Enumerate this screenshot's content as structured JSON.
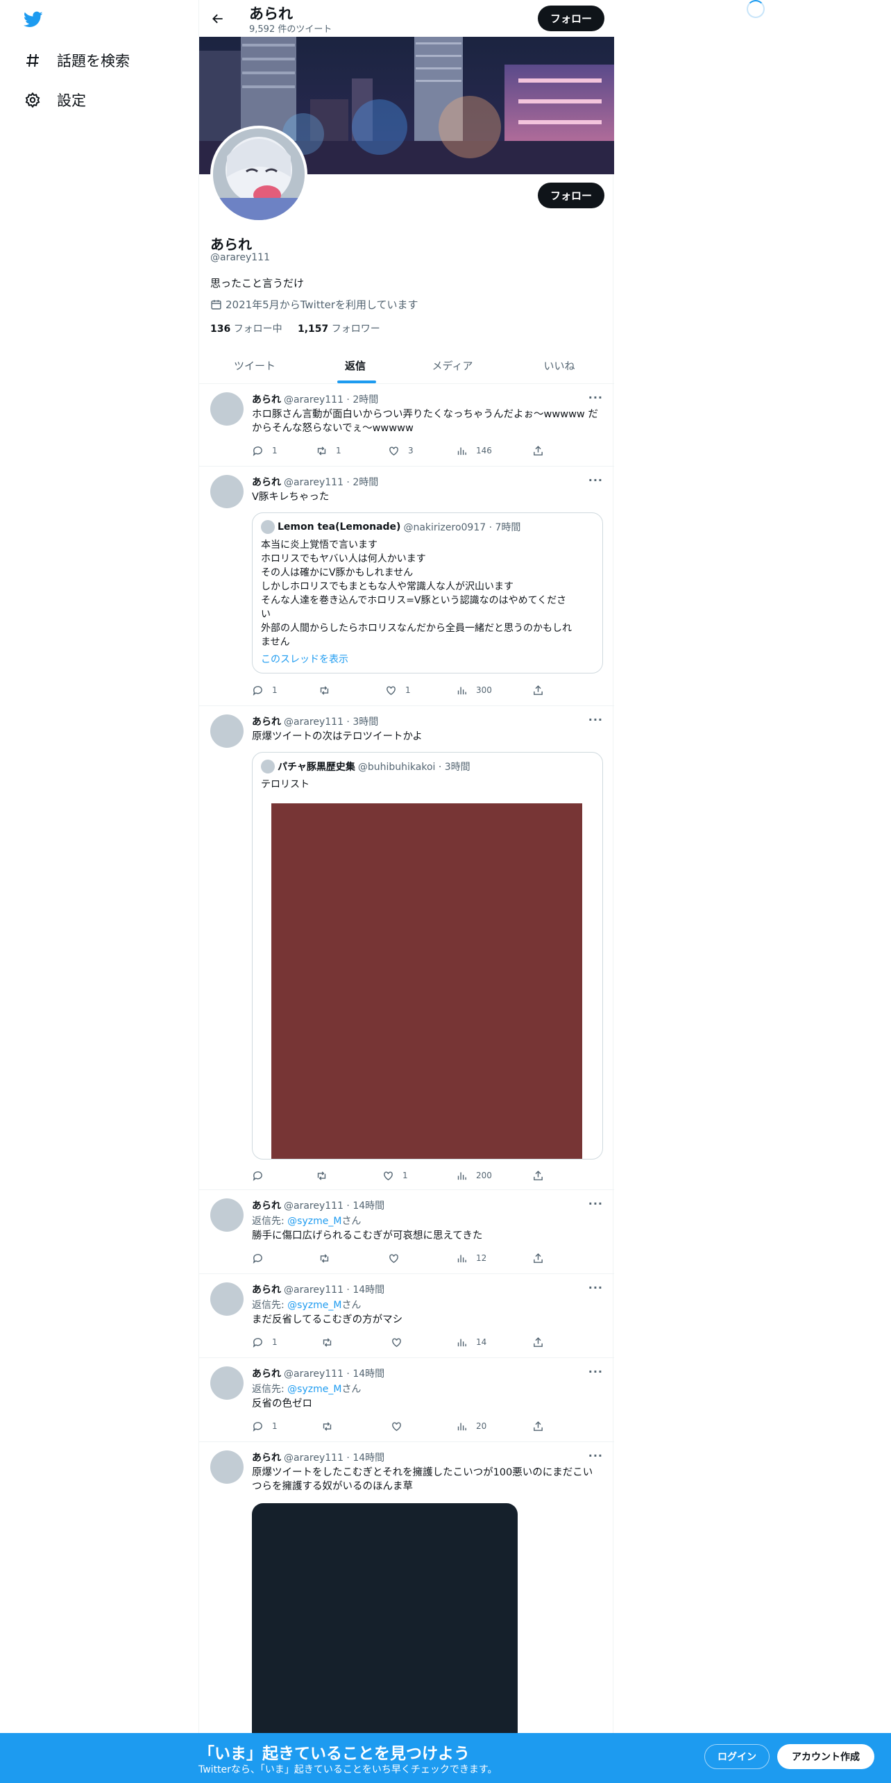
{
  "nav": {
    "explore_label": "話題を検索",
    "settings_label": "設定"
  },
  "header": {
    "name": "あられ",
    "tweet_count": "9,592 件のツイート",
    "follow_label": "フォロー"
  },
  "profile": {
    "name": "あられ",
    "handle": "@ararey111",
    "bio": "思ったこと言うだけ",
    "joined": "2021年5月からTwitterを利用しています",
    "following_count": "136",
    "following_label": "フォロー中",
    "followers_count": "1,157",
    "followers_label": "フォロワー",
    "follow_label": "フォロー"
  },
  "tabs": [
    "ツイート",
    "返信",
    "メディア",
    "いいね"
  ],
  "tweets": [
    {
      "name": "あられ",
      "meta": "@ararey111 · 2時間",
      "text": "ホロ豚さん言動が面白いからつい弄りたくなっちゃうんだよぉ～wwwww だからそんな怒らないでぇ～wwwww",
      "reply": "1",
      "retweet": "1",
      "like": "3",
      "views": "146"
    },
    {
      "name": "あられ",
      "meta": "@ararey111 · 2時間",
      "text": "V豚キレちゃった",
      "quote": {
        "name": "Lemon tea(Lemonade)",
        "meta": "@nakirizero0917 · 7時間",
        "lines": [
          "本当に炎上覚悟で言います",
          "ホロリスでもヤバい人は何人かいます",
          "その人は確かにV豚かもしれません",
          "しかしホロリスでもまともな人や常識人な人が沢山います",
          "そんな人達を巻き込んでホロリス=V豚という認識なのはやめてくださ",
          "い",
          "外部の人間からしたらホロリスなんだから全員一緒だと思うのかもしれ",
          "ません"
        ],
        "link": "このスレッドを表示"
      },
      "reply": "1",
      "retweet": "",
      "like": "1",
      "views": "300"
    },
    {
      "name": "あられ",
      "meta": "@ararey111 · 3時間",
      "text": "原爆ツイートの次はテロツイートかよ",
      "quote": {
        "name": "パチャ豚黒歴史集",
        "meta": "@buhibuhikakoi · 3時間",
        "text": "テロリスト"
      },
      "reply": "",
      "retweet": "",
      "like": "1",
      "views": "200"
    },
    {
      "name": "あられ",
      "meta": "@ararey111 · 14時間",
      "reply_prefix": "返信先: ",
      "reply_to": "@syzme_M",
      "reply_suffix": "さん",
      "text": "勝手に傷口広げられるこむぎが可哀想に思えてきた",
      "reply": "",
      "retweet": "",
      "like": "",
      "views": "12"
    },
    {
      "name": "あられ",
      "meta": "@ararey111 · 14時間",
      "reply_prefix": "返信先: ",
      "reply_to": "@syzme_M",
      "reply_suffix": "さん",
      "text": "まだ反省してるこむぎの方がマシ",
      "reply": "1",
      "retweet": "",
      "like": "",
      "views": "14"
    },
    {
      "name": "あられ",
      "meta": "@ararey111 · 14時間",
      "reply_prefix": "返信先: ",
      "reply_to": "@syzme_M",
      "reply_suffix": "さん",
      "text": "反省の色ゼロ",
      "reply": "1",
      "retweet": "",
      "like": "",
      "views": "20"
    },
    {
      "name": "あられ",
      "meta": "@ararey111 · 14時間",
      "text": "原爆ツイートをしたこむぎとそれを擁護したこいつが100悪いのにまだこいつらを擁護する奴がいるのほんま草"
    }
  ],
  "bottom": {
    "title": "「いま」起きていることを見つけよう",
    "subtitle": "Twitterなら、「いま」起きていることをいち早くチェックできます。",
    "login": "ログイン",
    "signup": "アカウント作成"
  },
  "colors": {
    "accent": "#1d9bf0",
    "quote_media": "#773535",
    "tweet_media": "#15202b"
  }
}
